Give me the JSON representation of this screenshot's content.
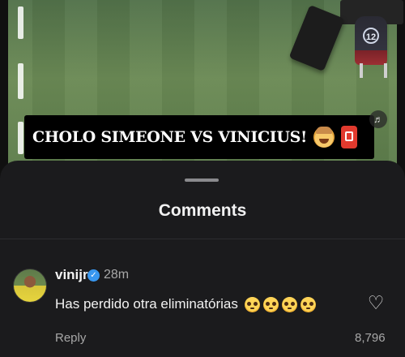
{
  "video": {
    "banner_title": "CHOLO SIMEONE VS VINICIUS!",
    "player_number": "12",
    "icons": [
      "exploding-head-icon",
      "red-card-icon",
      "volume-icon"
    ]
  },
  "comments_sheet": {
    "title": "Comments",
    "comment": {
      "username": "vinijr",
      "verified": true,
      "timestamp": "28m",
      "text": "Has perdido otra eliminatórias",
      "emoji": [
        "pleading-face-icon",
        "pleading-face-icon",
        "pleading-face-icon",
        "pleading-face-icon"
      ],
      "reply_label": "Reply",
      "like_count": "8,796"
    }
  },
  "colors": {
    "sheet_background": "#1b1b1d",
    "verified_badge": "#3897f0",
    "muted_text": "#a8a8a8"
  }
}
